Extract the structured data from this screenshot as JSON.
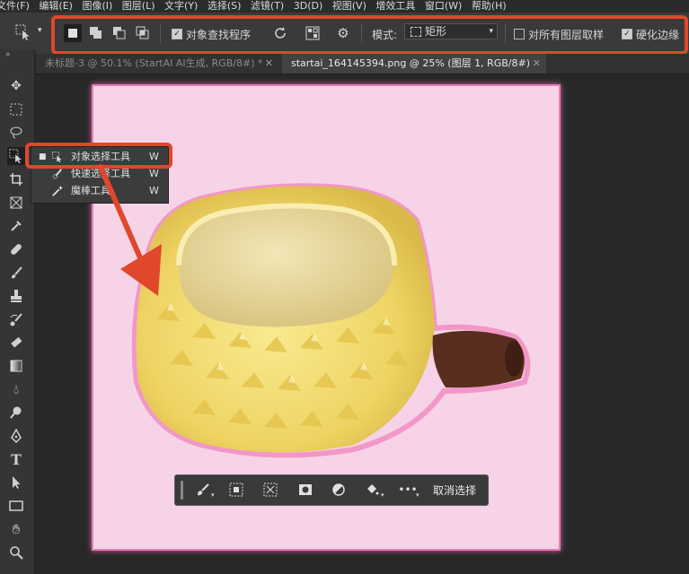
{
  "menu": [
    "文件(F)",
    "编辑(E)",
    "图像(I)",
    "图层(L)",
    "文字(Y)",
    "选择(S)",
    "滤镜(T)",
    "3D(D)",
    "视图(V)",
    "增效工具",
    "窗口(W)",
    "帮助(H)"
  ],
  "options": {
    "object_finder_label": "对象查找程序",
    "object_finder_checked": true,
    "mode_label": "模式:",
    "mode_value": "矩形",
    "sample_all_layers_label": "对所有图层取样",
    "sample_all_layers_checked": false,
    "hard_edge_label": "硬化边缘",
    "hard_edge_checked": true
  },
  "tabs": [
    {
      "label": "未标题-3 @ 50.1% (StartAI AI生成, RGB/8#) *",
      "active": false
    },
    {
      "label": "startai_164145394.png @ 25% (图层 1, RGB/8#)",
      "active": true
    }
  ],
  "flyout": {
    "items": [
      {
        "label": "对象选择工具",
        "shortcut": "W",
        "icon": "object-selection-icon",
        "selected": true
      },
      {
        "label": "快速选择工具",
        "shortcut": "W",
        "icon": "quick-selection-icon",
        "selected": false
      },
      {
        "label": "魔棒工具",
        "shortcut": "W",
        "icon": "magic-wand-icon",
        "selected": false
      }
    ]
  },
  "context_bar": {
    "deselect_label": "取消选择"
  },
  "colors": {
    "annotation": "#e0472b",
    "canvas_bg": "#f7d3e8",
    "selection_glow": "#e47db8"
  }
}
